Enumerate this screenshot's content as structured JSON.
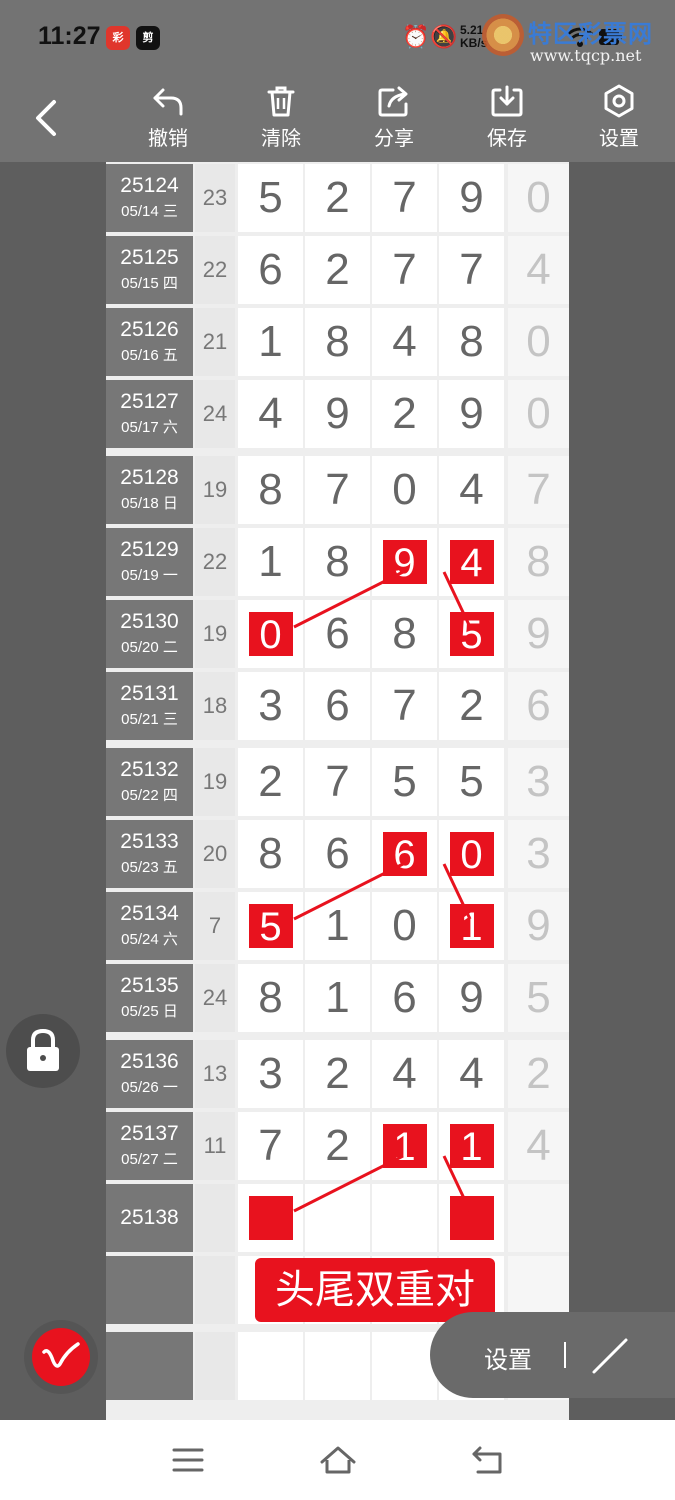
{
  "status_bar": {
    "time": "11:27",
    "app_badges": [
      "彩",
      "剪"
    ],
    "speed_value": "5.21",
    "speed_unit": "KB/s",
    "watermark_title": "特区彩票网",
    "watermark_url": "www.tqcp.net"
  },
  "toolbar": {
    "undo_label": "撤销",
    "clear_label": "清除",
    "share_label": "分享",
    "save_label": "保存",
    "settings_label": "设置"
  },
  "rows": [
    {
      "period": "25124",
      "date": "05/14 三",
      "sum": "23",
      "digits": [
        "5",
        "2",
        "7",
        "9"
      ],
      "extra": "0",
      "hl": [
        false,
        false,
        false,
        false
      ]
    },
    {
      "period": "25125",
      "date": "05/15 四",
      "sum": "22",
      "digits": [
        "6",
        "2",
        "7",
        "7"
      ],
      "extra": "4",
      "hl": [
        false,
        false,
        false,
        false
      ]
    },
    {
      "period": "25126",
      "date": "05/16 五",
      "sum": "21",
      "digits": [
        "1",
        "8",
        "4",
        "8"
      ],
      "extra": "0",
      "hl": [
        false,
        false,
        false,
        false
      ]
    },
    {
      "period": "25127",
      "date": "05/17 六",
      "sum": "24",
      "digits": [
        "4",
        "9",
        "2",
        "9"
      ],
      "extra": "0",
      "hl": [
        false,
        false,
        false,
        false
      ]
    },
    {
      "period": "25128",
      "date": "05/18 日",
      "sum": "19",
      "digits": [
        "8",
        "7",
        "0",
        "4"
      ],
      "extra": "7",
      "hl": [
        false,
        false,
        false,
        false
      ]
    },
    {
      "period": "25129",
      "date": "05/19 一",
      "sum": "22",
      "digits": [
        "1",
        "8",
        "9",
        "4"
      ],
      "extra": "8",
      "hl": [
        false,
        false,
        true,
        true
      ]
    },
    {
      "period": "25130",
      "date": "05/20 二",
      "sum": "19",
      "digits": [
        "0",
        "6",
        "8",
        "5"
      ],
      "extra": "9",
      "hl": [
        true,
        false,
        false,
        true
      ]
    },
    {
      "period": "25131",
      "date": "05/21 三",
      "sum": "18",
      "digits": [
        "3",
        "6",
        "7",
        "2"
      ],
      "extra": "6",
      "hl": [
        false,
        false,
        false,
        false
      ]
    },
    {
      "period": "25132",
      "date": "05/22 四",
      "sum": "19",
      "digits": [
        "2",
        "7",
        "5",
        "5"
      ],
      "extra": "3",
      "hl": [
        false,
        false,
        false,
        false
      ]
    },
    {
      "period": "25133",
      "date": "05/23 五",
      "sum": "20",
      "digits": [
        "8",
        "6",
        "6",
        "0"
      ],
      "extra": "3",
      "hl": [
        false,
        false,
        true,
        true
      ]
    },
    {
      "period": "25134",
      "date": "05/24 六",
      "sum": "7",
      "digits": [
        "5",
        "1",
        "0",
        "1"
      ],
      "extra": "9",
      "hl": [
        true,
        false,
        false,
        true
      ]
    },
    {
      "period": "25135",
      "date": "05/25 日",
      "sum": "24",
      "digits": [
        "8",
        "1",
        "6",
        "9"
      ],
      "extra": "5",
      "hl": [
        false,
        false,
        false,
        false
      ]
    },
    {
      "period": "25136",
      "date": "05/26 一",
      "sum": "13",
      "digits": [
        "3",
        "2",
        "4",
        "4"
      ],
      "extra": "2",
      "hl": [
        false,
        false,
        false,
        false
      ]
    },
    {
      "period": "25137",
      "date": "05/27 二",
      "sum": "11",
      "digits": [
        "7",
        "2",
        "1",
        "1"
      ],
      "extra": "4",
      "hl": [
        false,
        false,
        true,
        true
      ]
    },
    {
      "period": "25138",
      "date": "",
      "sum": "",
      "digits": [
        "",
        "",
        "",
        ""
      ],
      "extra": "",
      "hl": [
        true,
        false,
        false,
        true
      ]
    },
    {
      "period": "",
      "date": "",
      "sum": "",
      "digits": [
        "",
        "",
        "",
        ""
      ],
      "extra": "",
      "hl": [
        false,
        false,
        false,
        false
      ]
    },
    {
      "period": "",
      "date": "",
      "sum": "",
      "digits": [
        "",
        "",
        "",
        ""
      ],
      "extra": "",
      "hl": [
        false,
        false,
        false,
        false
      ]
    }
  ],
  "pattern_label": "头尾双重对",
  "floating": {
    "pill_settings_label": "设置"
  },
  "colors": {
    "highlight": "#e8121e",
    "toolbar_bg": "#737373",
    "period_bg": "#777777"
  }
}
